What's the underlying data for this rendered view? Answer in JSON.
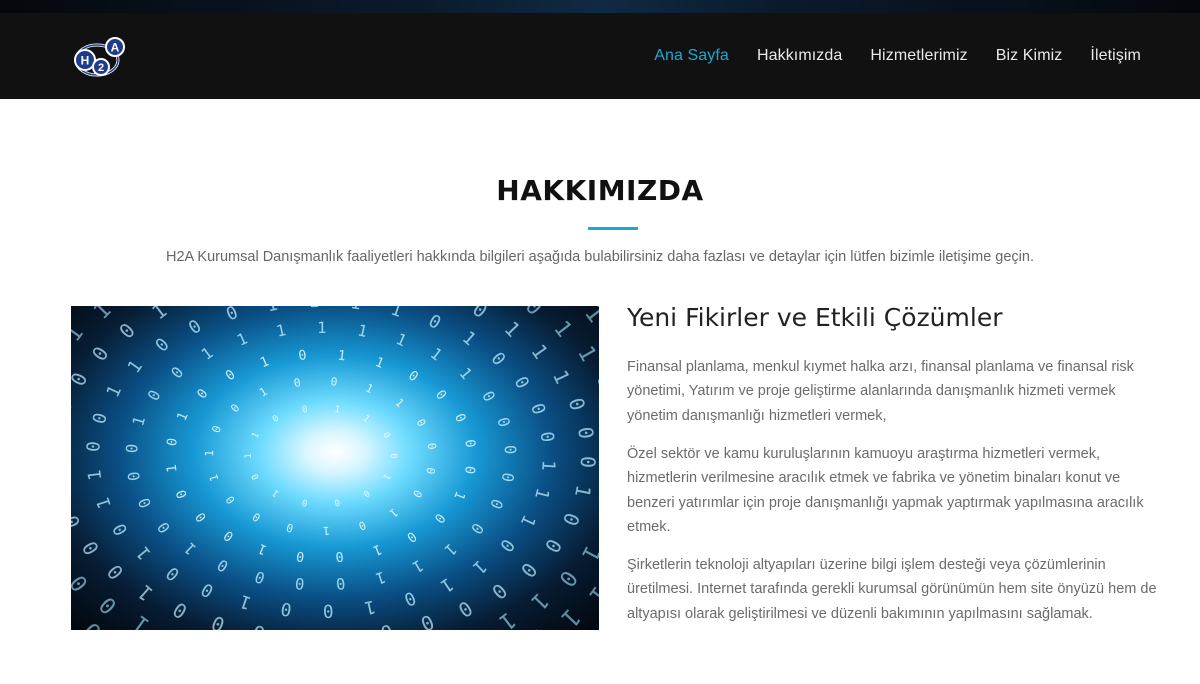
{
  "brand": {
    "logo_text": "H2A",
    "colors": {
      "accent": "#1aa9d6",
      "navbar_bg": "#111111",
      "text_dark": "#111111"
    }
  },
  "nav": {
    "items": [
      {
        "label": "Ana Sayfa",
        "active": true
      },
      {
        "label": "Hakkımızda",
        "active": false
      },
      {
        "label": "Hizmetlerimiz",
        "active": false
      },
      {
        "label": "Biz Kimiz",
        "active": false
      },
      {
        "label": "İletişim",
        "active": false
      }
    ]
  },
  "about": {
    "title": "HAKKIMIZDA",
    "intro": "H2A Kurumsal Danışmanlık faaliyetleri hakkında bilgileri aşağıda bulabilirsiniz daha fazlası ve detaylar için lütfen bizimle iletişime geçin.",
    "image": "binary-tunnel-image",
    "content_title": "Yeni Fikirler ve Etkili Çözümler",
    "paragraphs": [
      "Finansal planlama, menkul kıymet halka arzı, finansal planlama ve finansal risk yönetimi, Yatırım ve proje geliştirme alanlarında danışmanlık hizmeti vermek yönetim danışmanlığı hizmetleri vermek,",
      "Özel sektör ve kamu kuruluşlarının kamuoyu araştırma hizmetleri vermek, hizmetlerin verilmesine aracılık etmek ve fabrika ve yönetim binaları konut ve benzeri yatırımlar için proje danışmanlığı yapmak yaptırmak yapılmasına aracılık etmek.",
      "Şirketlerin teknoloji altyapıları üzerine bilgi işlem desteği veya çözümlerinin üretilmesi. Internet tarafında gerekli kurumsal görünümün hem site önyüzü hem de altyapısı olarak geliştirilmesi ve düzenli bakımının yapılmasını sağlamak."
    ]
  }
}
